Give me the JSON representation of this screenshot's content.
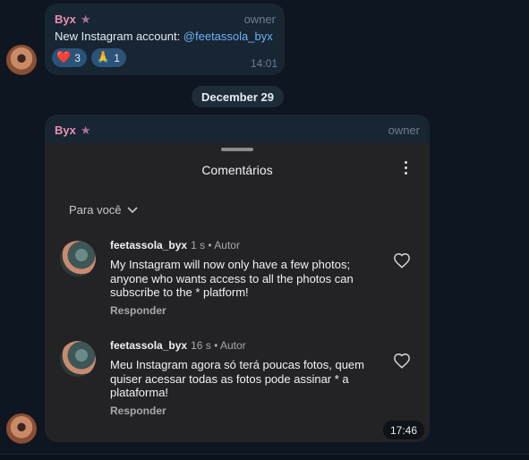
{
  "message1": {
    "sender": "Byx",
    "role": "owner",
    "text_prefix": "New Instagram account: ",
    "mention": "@feetassola_byx",
    "reactions": [
      {
        "emoji": "❤️",
        "count": "3"
      },
      {
        "emoji": "🙏",
        "count": "1"
      }
    ],
    "time": "14:01"
  },
  "date_separator": "December 29",
  "message2": {
    "sender": "Byx",
    "role": "owner",
    "time": "17:46",
    "screenshot": {
      "title": "Comentários",
      "filter": "Para você",
      "comments": [
        {
          "username": "feetassola_byx",
          "meta": "1 s • Autor",
          "text": "My Instagram will now only have a few photos; anyone who wants access to all the photos can subscribe to the * platform!",
          "reply": "Responder"
        },
        {
          "username": "feetassola_byx",
          "meta": "16 s • Autor",
          "text": "Meu Instagram agora só terá poucas fotos, quem quiser acessar todas as fotos pode assinar * a plataforma!",
          "reply": "Responder"
        }
      ]
    }
  },
  "colors": {
    "background": "#0e1621",
    "bubble": "#182533",
    "sender_name": "#e98fb4",
    "link": "#6ab3f3",
    "reaction_bg": "#2b5278"
  }
}
